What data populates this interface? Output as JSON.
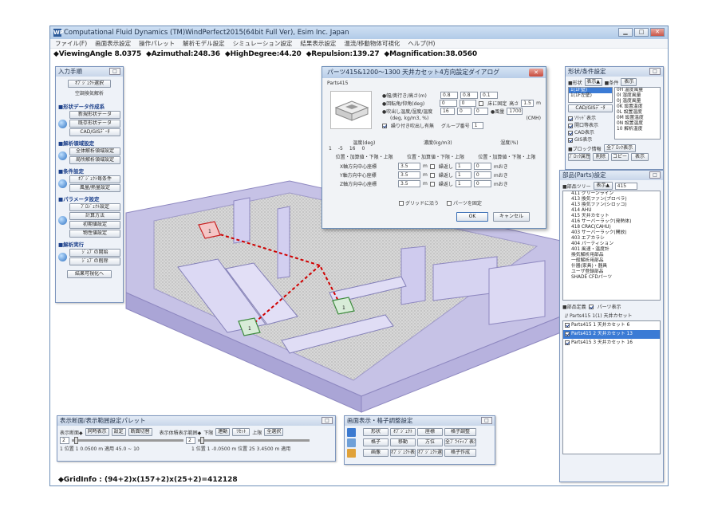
{
  "window": {
    "title": "Computational Fluid Dynamics (TM)WindPerfect2015(64bit Full Ver), Esim Inc. Japan",
    "logo": "WP",
    "controls": [
      "minimize",
      "maximize",
      "close"
    ]
  },
  "menu": [
    "ファイル(F)",
    "画面表示設定",
    "操作パレット",
    "解析モデル設定",
    "シミュレーション設定",
    "結果表示設定",
    "温流/移動物体可視化",
    "ヘルプ(H)"
  ],
  "info": {
    "viewing_angle": "◆ViewingAngle 8.0375",
    "azimuthal": "◆Azimuthal:248.36",
    "high_degree": "◆HighDegree:44.20",
    "repulsion": "◆Repulsion:139.27",
    "magnification": "◆Magnification:38.0560"
  },
  "left_panel": {
    "title": "入力手順",
    "top_button": "ｵﾌﾞｼﾞｪｸﾄ選択",
    "top_label": "空調換気解析",
    "sections": [
      {
        "name": "■形状データ作成系",
        "buttons": [
          "新規形状データ",
          "既存形状データ",
          "CAD/GISﾃﾞｰﾀ"
        ]
      },
      {
        "name": "■解析領域設定",
        "buttons": [
          "全体解析領域設定",
          "局所解析領域設定"
        ]
      },
      {
        "name": "■条件設定",
        "buttons": [
          "ｵﾌﾞｼﾞｪｸﾄ毎条件",
          "風量/熱量設定"
        ]
      },
      {
        "name": "■パラメータ設定",
        "buttons": [
          "ﾌﾟﾛｼﾞｪｸﾄ設定",
          "計算方法",
          "初期値設定",
          "物性値設定"
        ]
      },
      {
        "name": "■解析実行",
        "buttons": [
          "ｼﾞｮﾌﾞの開始",
          "ｼﾞｮﾌﾞの削除"
        ]
      }
    ],
    "bottom_button": "結果可視化へ"
  },
  "dialog": {
    "title": "パーツ415&1200～1300 天井カセット4方向設定ダイアログ",
    "part_name": "Parts415",
    "size_label": "●幅/奥行き/高さ(m)",
    "size_values": [
      "0.8",
      "0.8",
      "0.1"
    ],
    "rotation_label": "●回転角/仰角(deg)",
    "rotation_values": [
      "0",
      "0"
    ],
    "floor_fix_label": "床に固定",
    "height_label": "高さ",
    "height_value": "1.5",
    "height_unit": "m",
    "blow_label": "●吹出し温度/湿度/温度",
    "blow_sublabel": "(deg, kg/m3, %)",
    "blow_values": [
      "16",
      "0",
      "0"
    ],
    "airflow_label": "●風量",
    "airflow_value": "1700",
    "airflow_unit": "(CMH)",
    "return_label": "繰り付き吹出し有無",
    "group_label": "グループ番号",
    "group_value": "1",
    "col_temp": "温度(deg)",
    "col_density": "濃度(kg/m3)",
    "col_humidity": "湿度(%)",
    "row1_values": [
      "1",
      "-5",
      "16",
      "0"
    ],
    "offset_headers": [
      "位置・加算値・下限・上限",
      "位置・加算値・下限・上限",
      "位置・加算値・下限・上限"
    ],
    "axis_rows": [
      {
        "label": "X軸方向中心座標",
        "value": "3.5",
        "unit": "m",
        "repeat": "繰返し",
        "count": "1",
        "step": "0",
        "tail": "mおき"
      },
      {
        "label": "Y軸方向中心座標",
        "value": "3.5",
        "unit": "m",
        "repeat": "繰返し",
        "count": "1",
        "step": "0",
        "tail": "mおき"
      },
      {
        "label": "Z軸方向中心座標",
        "value": "3.5",
        "unit": "m",
        "repeat": "繰返し",
        "count": "1",
        "step": "0",
        "tail": "mおき"
      }
    ],
    "grid_label": "グリッドに沿う",
    "fixed_label": "パーツを固定",
    "ok": "OK",
    "cancel": "キャンセル"
  },
  "shape_panel": {
    "title": "形状/条件設定",
    "shape_label": "■形状",
    "shape_btn": "表示▲",
    "cond_label": "■条件",
    "cond_btn": "表示",
    "shape_list": [
      "1(1F壁)",
      "1(1F左壁)"
    ],
    "cond_list": [
      "0H 温度風量",
      "0I 湿度風量",
      "0J 温度風量",
      "0K 設置温度",
      "0L 設置温度",
      "0M 設置温度",
      "0N 設置温度",
      "10 解析温度"
    ],
    "cad_btn": "CAD/GISﾃﾞｰﾀ",
    "checks": [
      "ｿﾘｯﾄﾞ表示",
      "開口等表示",
      "CAD表示",
      "GIS表示"
    ],
    "block_label": "■ブロック情報",
    "block_btn": "全ﾌﾞﾛｯｸ表示",
    "bottom_btns": [
      "ﾌﾞﾛｯｸ属性",
      "削除",
      "コピー",
      "表示"
    ]
  },
  "parts_panel": {
    "title": "部品(Parts)設定",
    "tree_label": "■部品ツリー",
    "tree_btn": "表示▲",
    "tree_value": "415",
    "tree_items": [
      "411 グリーンライン",
      "413 換気ファン(プロペラ)",
      "413 換気ファン(シロッコ)",
      "414 AHU",
      "415 天井カセット",
      "416 サーバーラック(発熱体)",
      "418 CRAC(CAHU)",
      "403 サーバーラック(開放)",
      "403 エアカラシ",
      "404 パーティション",
      "401 風速・温度計",
      "換気解析用部品",
      "一般解析用部品",
      "什器(家具)・器具",
      "ユーザ登録部品",
      "SHADE CFDパーツ"
    ],
    "define_label": "■部品定義",
    "parts_display": "パーツ表示",
    "group_title": "// Parts415 1(1) 天井カセット",
    "instances": [
      "Parts415 1 天井カセット 6",
      "Parts415 2 天井カセット 13",
      "Parts415 3 天井カセット 16"
    ]
  },
  "range_panel": {
    "title": "表示断面/表示範囲設定パレット",
    "axis_label": "表示断面◆",
    "axis_btns": [
      "同時表示",
      "設定",
      "断面切替"
    ],
    "range_label": "表示体積表示範囲◆",
    "lower": "下限",
    "upper": "上限",
    "range_btns": [
      "連動",
      "ﾘｾｯﾄ"
    ],
    "all_btn": "全選択",
    "slider1_val": "2",
    "slider2_val": "2",
    "pos1": "1   位置 1   0.0500 m 適用  45.0 ~ 10",
    "pos2": "1   位置 1   -0.0500 m  位置 25   3.4500 m 適用"
  },
  "display_panel": {
    "title": "画面表示・格子調整設定",
    "buttons": [
      "形状",
      "ｵﾌﾞｼﾞｪｸﾄ",
      "座標",
      "格子調整",
      "格子",
      "移動",
      "方位",
      "全ﾌﾟﾗｲﾃｨﾌﾞ表示",
      "画像",
      "ｵﾌﾞｼﾞｪｸﾄ表示",
      "ｵﾌﾞｼﾞｪｸﾄ選択",
      "格子作成"
    ]
  },
  "grid_info": "◆GridInfo : (94+2)x(157+2)x(25+2)=412128",
  "colors": {
    "accent": "#3b7bd5",
    "model_wall": "#c9c4e6",
    "duct": "#d00000"
  }
}
